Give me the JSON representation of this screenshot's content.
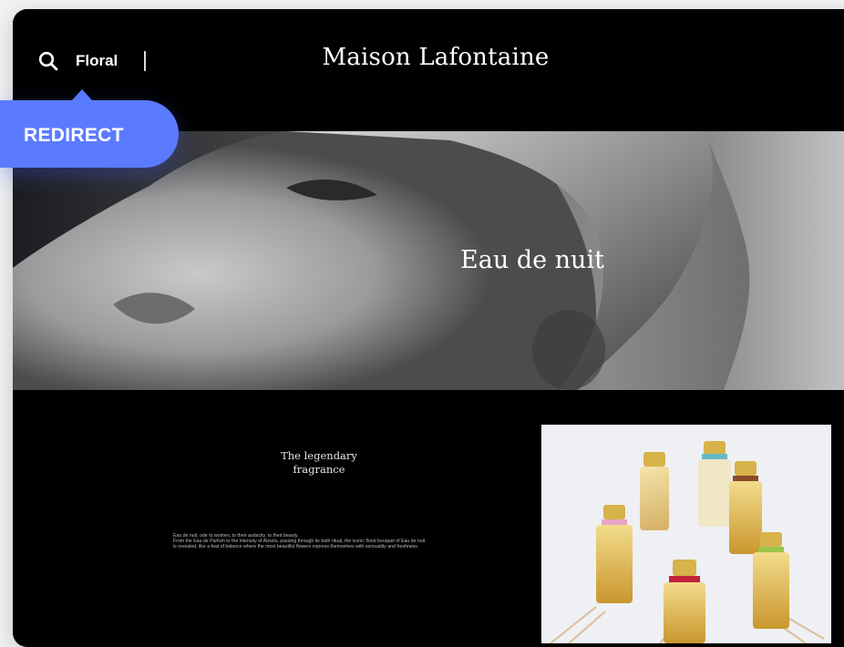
{
  "header": {
    "search_term": "Floral",
    "brand": "Maison Lafontaine"
  },
  "badge": {
    "label": "REDIRECT"
  },
  "hero": {
    "title": "Eau de nuit"
  },
  "content": {
    "tagline_line1": "The legendary",
    "tagline_line2": "fragrance",
    "description_line1": "Eau de nuit, ode to women, to their audacity, to their beauty.",
    "description_line2": "From the Eau de Parfum to the intensity of Absolu, passing through its bath ritual, the iconic floral bouquet of Eau de nuit",
    "description_line3": "is revealed, like a feat of balance where the most beautiful flowers express themselves with sensuality and freshness."
  },
  "colors": {
    "accent": "#5b7bff",
    "background": "#000000",
    "text": "#ffffff"
  }
}
